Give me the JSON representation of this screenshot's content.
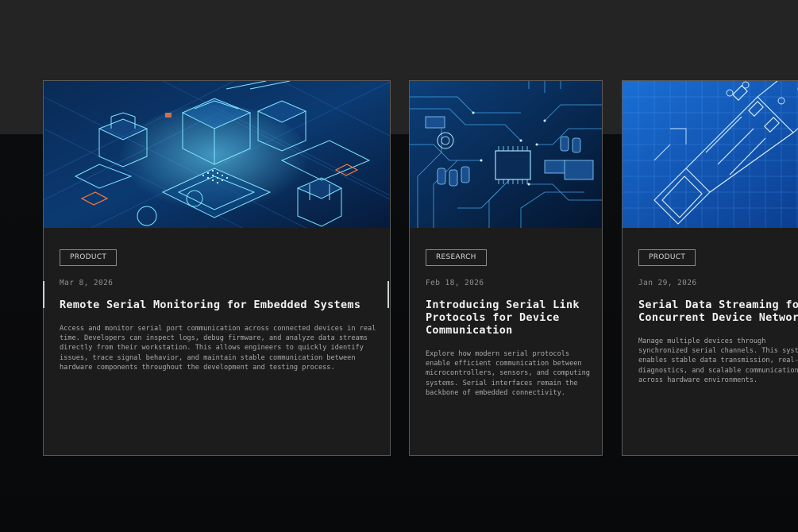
{
  "cards": [
    {
      "tag": "PRODUCT",
      "date": "Mar 8, 2026",
      "title": "Remote Serial Monitoring for Embedded Systems",
      "description": "Access and monitor serial port communication across connected devices in real time. Developers can inspect logs, debug firmware, and analyze data streams directly from their workstation. This allows engineers to quickly identify issues, trace signal behavior, and maintain stable communication between hardware components throughout the development and testing process.",
      "image": "isometric-chip-illustration"
    },
    {
      "tag": "RESEARCH",
      "date": "Feb 18, 2026",
      "title": "Introducing Serial Link Protocols for Device Communication",
      "description": "Explore how modern serial protocols enable efficient communication between microcontrollers, sensors, and computing systems. Serial interfaces remain the backbone of embedded connectivity.",
      "image": "circuit-board-illustration"
    },
    {
      "tag": "PRODUCT",
      "date": "Jan 29, 2026",
      "title": "Serial Data Streaming for Concurrent Device Networks",
      "description": "Manage multiple devices through synchronized serial channels. This system enables stable data transmission, real-time diagnostics, and scalable communication across hardware environments.",
      "image": "usb-blueprint-illustration"
    }
  ],
  "colors": {
    "page_top": "#242424",
    "page_bottom": "#08090b",
    "card_bg": "#1c1c1c",
    "accent_blue": "#1e6fd9",
    "accent_cyan": "#6fe3ff",
    "accent_orange": "#ff7a3d"
  }
}
